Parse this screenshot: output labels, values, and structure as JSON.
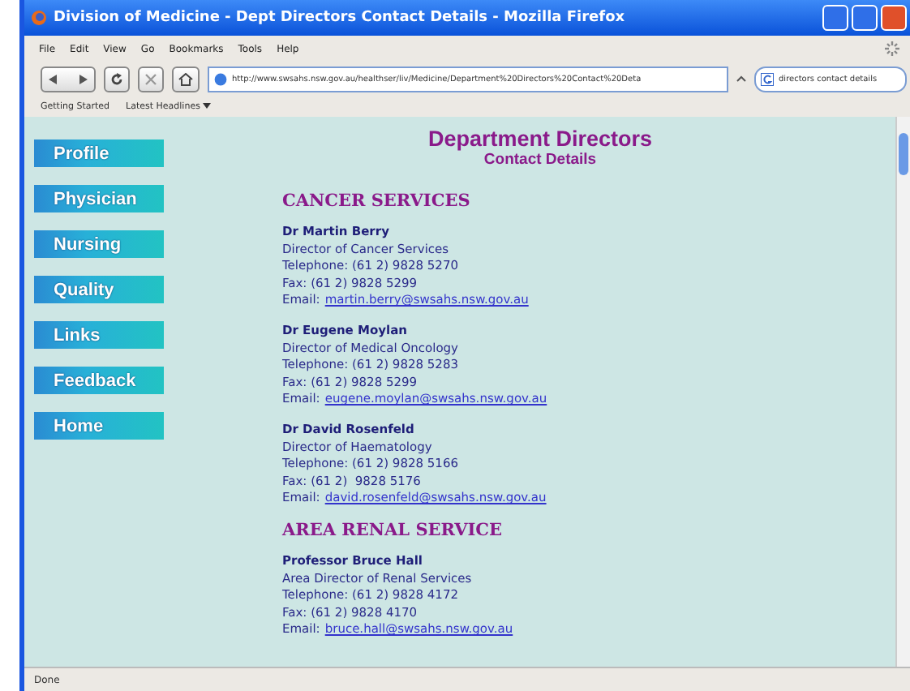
{
  "window": {
    "title": "Division of Medicine - Dept Directors Contact Details - Mozilla Firefox"
  },
  "menu": [
    "File",
    "Edit",
    "View",
    "Go",
    "Bookmarks",
    "Tools",
    "Help"
  ],
  "address_bar": {
    "value": "http://www.swsahs.nsw.gov.au/healthser/liv/Medicine/Department%20Directors%20Contact%20Deta"
  },
  "search": {
    "value": "directors contact details"
  },
  "bookmarks": [
    {
      "label": "Getting Started",
      "kind": "link"
    },
    {
      "label": "Latest Headlines",
      "kind": "feed"
    }
  ],
  "nav": [
    "Profile",
    "Physician",
    "Nursing",
    "Quality",
    "Links",
    "Feedback",
    "Home"
  ],
  "page": {
    "title": "Department Directors",
    "subtitle": "Contact Details",
    "sections": [
      {
        "heading": "CANCER SERVICES",
        "contacts": [
          {
            "name": "Dr Martin Berry",
            "role": "Director of Cancer Services",
            "telephone": "Telephone: (61 2) 9828 5270",
            "fax": "Fax: (61 2) 9828 5299",
            "email_label": "Email:",
            "email": "martin.berry@swsahs.nsw.gov.au"
          },
          {
            "name": "Dr Eugene Moylan",
            "role": "Director of Medical Oncology",
            "telephone": "Telephone: (61 2) 9828 5283",
            "fax": "Fax: (61 2) 9828 5299",
            "email_label": "Email:",
            "email": "eugene.moylan@swsahs.nsw.gov.au"
          },
          {
            "name": "Dr David Rosenfeld",
            "role": "Director of Haematology",
            "telephone": "Telephone: (61 2) 9828 5166",
            "fax": "Fax: (61 2)  9828 5176",
            "email_label": "Email:",
            "email": "david.rosenfeld@swsahs.nsw.gov.au"
          }
        ]
      },
      {
        "heading": "AREA RENAL SERVICE",
        "contacts": [
          {
            "name": "Professor Bruce Hall",
            "role": "Area Director of Renal Services",
            "telephone": "Telephone: (61 2) 9828 4172",
            "fax": "Fax: (61 2) 9828 4170",
            "email_label": "Email:",
            "email": "bruce.hall@swsahs.nsw.gov.au"
          }
        ]
      }
    ]
  },
  "status_bar": "Done"
}
